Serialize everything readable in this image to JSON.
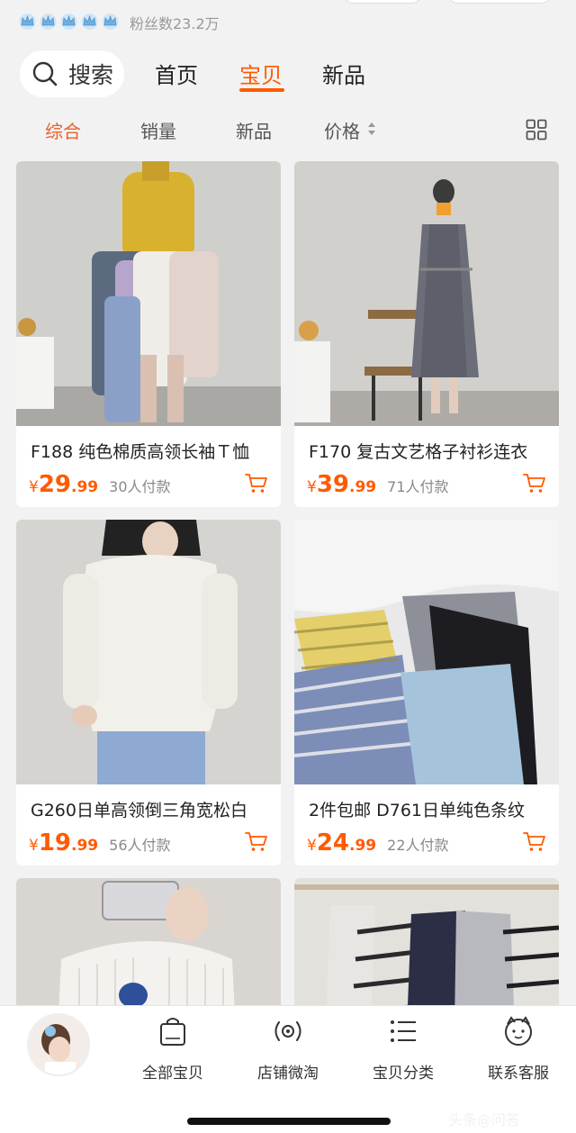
{
  "shop": {
    "fans": "粉丝数23.2万",
    "level_icon": "crown-icon",
    "level_count": 5
  },
  "nav": {
    "search_label": "搜索",
    "tabs": [
      {
        "label": "首页",
        "active": false
      },
      {
        "label": "宝贝",
        "active": true
      },
      {
        "label": "新品",
        "active": false
      }
    ]
  },
  "sort": {
    "items": [
      {
        "label": "综合",
        "active": true
      },
      {
        "label": "销量",
        "active": false
      },
      {
        "label": "新品",
        "active": false
      },
      {
        "label": "价格",
        "active": false
      }
    ],
    "layout_toggle_icon": "grid-view-icon"
  },
  "products": [
    {
      "title": "F188 纯色棉质高领长袖Ｔ恤",
      "currency": "¥",
      "price_int": "29",
      "price_dec": ".99",
      "sold": "30人付款"
    },
    {
      "title": "F170 复古文艺格子衬衫连衣",
      "currency": "¥",
      "price_int": "39",
      "price_dec": ".99",
      "sold": "71人付款"
    },
    {
      "title": "G260日单高领倒三角宽松白",
      "currency": "¥",
      "price_int": "19",
      "price_dec": ".99",
      "sold": "56人付款"
    },
    {
      "title": "2件包邮  D761日单纯色条纹",
      "currency": "¥",
      "price_int": "24",
      "price_dec": ".99",
      "sold": "22人付款"
    }
  ],
  "bottom_bar": {
    "items": [
      {
        "label": "全部宝贝",
        "icon": "shopping-bag-icon"
      },
      {
        "label": "店铺微淘",
        "icon": "broadcast-icon"
      },
      {
        "label": "宝贝分类",
        "icon": "list-icon"
      },
      {
        "label": "联系客服",
        "icon": "customer-service-icon"
      }
    ]
  },
  "watermark": "头条@问答",
  "colors": {
    "accent": "#ff5a00",
    "sort_active": "#e8622c",
    "crown": "#7fb8e6",
    "background": "#f2f2f2"
  }
}
